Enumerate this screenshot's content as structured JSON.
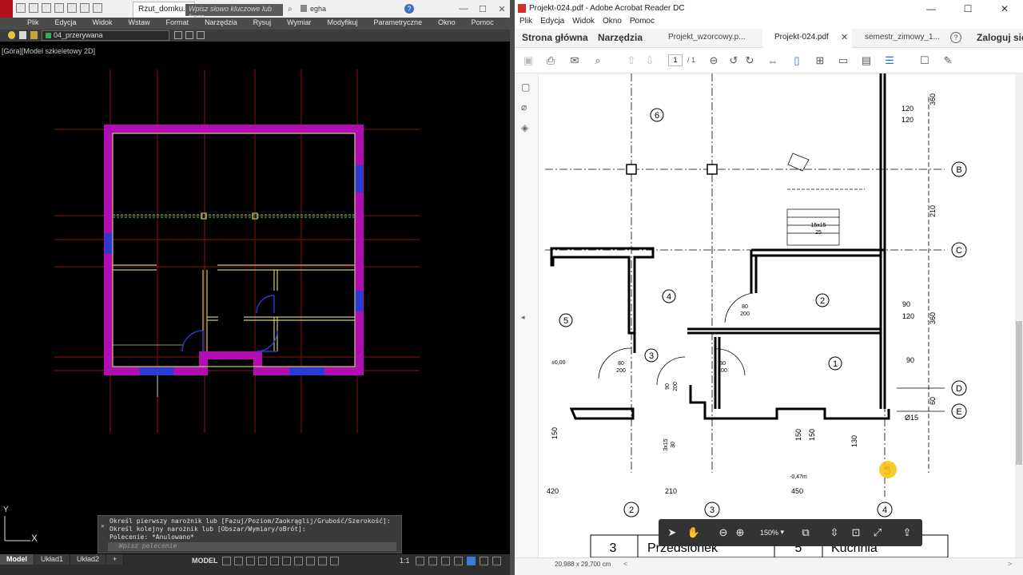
{
  "autocad": {
    "tab_title": "Rzut_domku...",
    "search_placeholder": "Wpisz słowo kluczowe lub frazę",
    "username": "egha",
    "menu": [
      "Plik",
      "Edycja",
      "Widok",
      "Wstaw",
      "Format",
      "Narzędzia",
      "Rysuj",
      "Wymiar",
      "Modyfikuj",
      "Parametryczne",
      "Okno",
      "Pomoc"
    ],
    "layer_name": "04_przerywana",
    "viewport_label": "[Góra][Model szkieletowy 2D]",
    "ucs_x": "X",
    "ucs_y": "Y",
    "command_lines": [
      "Określ pierwszy narożnik lub [Fazuj/Poziom/Zaokrąglij/Grubość/Szerokość]:",
      "Określ kolejny narożnik lub [Obszar/Wymiary/oBrót]:",
      "Polecenie: *Anulowano*"
    ],
    "command_placeholder": "Wpisz polecenie",
    "layout_tabs": [
      "Model",
      "Układ1",
      "Układ2"
    ],
    "status_model": "MODEL",
    "status_scale": "1:1",
    "colors": {
      "walls": "#b10db1",
      "lines": "#c8c87a",
      "grid": "#8b0000",
      "doors": "#2a3bd4"
    }
  },
  "acrobat": {
    "window_title": "Projekt-024.pdf - Adobe Acrobat Reader DC",
    "menu": [
      "Plik",
      "Edycja",
      "Widok",
      "Okno",
      "Pomoc"
    ],
    "home_tab": "Strona główna",
    "tools_tab": "Narzędzia",
    "doc_tabs": [
      "Projekt_wzorcowy.p...",
      "Projekt-024.pdf",
      "semestr_zimowy_1..."
    ],
    "login": "Zaloguj się",
    "page_number": "1",
    "page_count": "/ 1",
    "zoom": "150%",
    "page_size": "20,988 x 29,700 cm",
    "drawing": {
      "rooms": [
        "1",
        "2",
        "3",
        "4",
        "5",
        "6"
      ],
      "axes_letters": [
        "B",
        "C",
        "D",
        "E"
      ],
      "axes_numbers": [
        "2",
        "3",
        "4"
      ],
      "dims_right": [
        "360",
        "210",
        "360",
        "60"
      ],
      "dims_misc": [
        "120",
        "120",
        "90",
        "120",
        "90",
        "Ø15",
        "130",
        "150",
        "150",
        "150",
        "420",
        "210",
        "450",
        "±0,00",
        "-0,47m"
      ],
      "door_labels": [
        "80",
        "200",
        "80",
        "200",
        "80",
        "200",
        "80",
        "200",
        "90",
        "200"
      ],
      "stair_label": [
        "15x15",
        "25"
      ],
      "window_label": [
        "3x15",
        "30"
      ],
      "table_cells": [
        "3",
        "Przedsionek",
        "5",
        "Kuchnia"
      ]
    }
  }
}
